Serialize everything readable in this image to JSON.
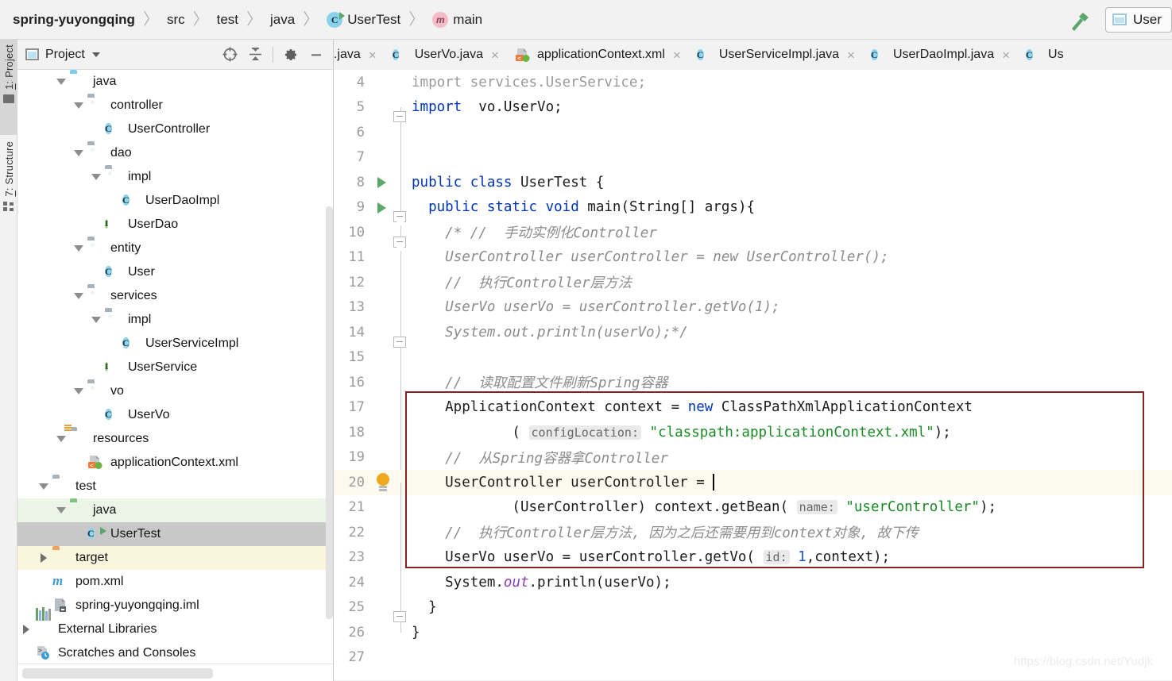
{
  "breadcrumb": {
    "items": [
      {
        "label": "spring-yuyongqing",
        "icon": "none",
        "bold": true
      },
      {
        "label": "src",
        "icon": "none",
        "bold": false
      },
      {
        "label": "test",
        "icon": "none",
        "bold": false
      },
      {
        "label": "java",
        "icon": "none",
        "bold": false
      },
      {
        "label": "UserTest",
        "icon": "class-runnable-icon",
        "bold": false
      },
      {
        "label": "main",
        "icon": "method-icon",
        "bold": false
      }
    ],
    "separator": "〉"
  },
  "toolbar": {
    "build_icon": "hammer-icon",
    "run_config_label": "User",
    "run_config_icon": "run-configuration-icon"
  },
  "tool_strip": {
    "tabs": [
      {
        "num": "1:",
        "label": " Project",
        "icon": "project-folder-icon",
        "active": true
      },
      {
        "num": "7:",
        "label": " Structure",
        "icon": "structure-icon",
        "active": false
      }
    ]
  },
  "project_panel": {
    "title": "Project",
    "title_icon": "project-window-icon",
    "dropdown_icon": "chevron-down-icon",
    "header_buttons": [
      {
        "name": "locate-icon",
        "tooltip": "Select Opened File"
      },
      {
        "name": "collapse-all-icon",
        "tooltip": "Collapse All"
      },
      {
        "name": "gear-icon",
        "tooltip": "Settings"
      },
      {
        "name": "minimize-icon",
        "tooltip": "Hide"
      }
    ],
    "tree": [
      {
        "label": "java",
        "depth": 3,
        "icon": "folder-source-blue-icon",
        "twisty": "open",
        "state": "normal"
      },
      {
        "label": "controller",
        "depth": 4,
        "icon": "folder-package-icon",
        "twisty": "open",
        "state": "normal"
      },
      {
        "label": "UserController",
        "depth": 5,
        "icon": "class-icon",
        "twisty": "none",
        "state": "normal"
      },
      {
        "label": "dao",
        "depth": 4,
        "icon": "folder-package-icon",
        "twisty": "open",
        "state": "normal"
      },
      {
        "label": "impl",
        "depth": 5,
        "icon": "folder-package-icon",
        "twisty": "open",
        "state": "normal"
      },
      {
        "label": "UserDaoImpl",
        "depth": 6,
        "icon": "class-icon",
        "twisty": "none",
        "state": "normal"
      },
      {
        "label": "UserDao",
        "depth": 5,
        "icon": "interface-icon",
        "twisty": "none",
        "state": "normal"
      },
      {
        "label": "entity",
        "depth": 4,
        "icon": "folder-package-icon",
        "twisty": "open",
        "state": "normal"
      },
      {
        "label": "User",
        "depth": 5,
        "icon": "class-icon",
        "twisty": "none",
        "state": "normal"
      },
      {
        "label": "services",
        "depth": 4,
        "icon": "folder-package-icon",
        "twisty": "open",
        "state": "normal"
      },
      {
        "label": "impl",
        "depth": 5,
        "icon": "folder-package-icon",
        "twisty": "open",
        "state": "normal"
      },
      {
        "label": "UserServiceImpl",
        "depth": 6,
        "icon": "class-icon",
        "twisty": "none",
        "state": "normal"
      },
      {
        "label": "UserService",
        "depth": 5,
        "icon": "interface-icon",
        "twisty": "none",
        "state": "normal"
      },
      {
        "label": "vo",
        "depth": 4,
        "icon": "folder-package-icon",
        "twisty": "open",
        "state": "normal"
      },
      {
        "label": "UserVo",
        "depth": 5,
        "icon": "class-icon",
        "twisty": "none",
        "state": "normal"
      },
      {
        "label": "resources",
        "depth": 3,
        "icon": "folder-resources-icon",
        "twisty": "open",
        "state": "normal"
      },
      {
        "label": "applicationContext.xml",
        "depth": 4,
        "icon": "spring-xml-icon",
        "twisty": "none",
        "state": "normal"
      },
      {
        "label": "test",
        "depth": 2,
        "icon": "folder-gray-icon",
        "twisty": "open",
        "state": "normal"
      },
      {
        "label": "java",
        "depth": 3,
        "icon": "folder-test-green-icon",
        "twisty": "open",
        "state": "test-root"
      },
      {
        "label": "UserTest",
        "depth": 4,
        "icon": "class-runnable-icon",
        "twisty": "none",
        "state": "selected"
      },
      {
        "label": "target",
        "depth": 2,
        "icon": "folder-excluded-icon",
        "twisty": "closed",
        "state": "excluded"
      },
      {
        "label": "pom.xml",
        "depth": 2,
        "icon": "maven-icon",
        "twisty": "none",
        "state": "normal"
      },
      {
        "label": "spring-yuyongqing.iml",
        "depth": 2,
        "icon": "iml-module-icon",
        "twisty": "none",
        "state": "normal"
      },
      {
        "label": "External Libraries",
        "depth": 1,
        "icon": "libraries-icon",
        "twisty": "closed",
        "state": "normal"
      },
      {
        "label": "Scratches and Consoles",
        "depth": 1,
        "icon": "scratches-icon",
        "twisty": "none",
        "state": "normal"
      }
    ]
  },
  "editor_tabs": [
    {
      "label": ".java",
      "icon": "none",
      "clipped": true,
      "close": "×"
    },
    {
      "label": "UserVo.java",
      "icon": "class-icon",
      "clipped": false,
      "close": "×"
    },
    {
      "label": "applicationContext.xml",
      "icon": "spring-xml-icon",
      "clipped": false,
      "close": "×"
    },
    {
      "label": "UserServiceImpl.java",
      "icon": "class-icon",
      "clipped": false,
      "close": "×"
    },
    {
      "label": "UserDaoImpl.java",
      "icon": "class-icon",
      "clipped": false,
      "close": "×"
    },
    {
      "label": "Us",
      "icon": "class-icon",
      "clipped": false,
      "close": ""
    }
  ],
  "code": {
    "first_visible_line": 4,
    "lines": [
      {
        "num": "4",
        "gutter": "",
        "fold": "",
        "highlight": false
      },
      {
        "num": "5",
        "gutter": "",
        "fold": "end",
        "highlight": false
      },
      {
        "num": "6",
        "gutter": "",
        "fold": "",
        "highlight": false
      },
      {
        "num": "7",
        "gutter": "",
        "fold": "",
        "highlight": false
      },
      {
        "num": "8",
        "gutter": "run",
        "fold": "",
        "highlight": false
      },
      {
        "num": "9",
        "gutter": "run",
        "fold": "start",
        "highlight": false
      },
      {
        "num": "10",
        "gutter": "",
        "fold": "start",
        "highlight": false
      },
      {
        "num": "11",
        "gutter": "",
        "fold": "",
        "highlight": false
      },
      {
        "num": "12",
        "gutter": "",
        "fold": "",
        "highlight": false
      },
      {
        "num": "13",
        "gutter": "",
        "fold": "",
        "highlight": false
      },
      {
        "num": "14",
        "gutter": "",
        "fold": "end",
        "highlight": false
      },
      {
        "num": "15",
        "gutter": "",
        "fold": "",
        "highlight": false
      },
      {
        "num": "16",
        "gutter": "",
        "fold": "",
        "highlight": false
      },
      {
        "num": "17",
        "gutter": "",
        "fold": "",
        "highlight": false
      },
      {
        "num": "18",
        "gutter": "",
        "fold": "",
        "highlight": false
      },
      {
        "num": "19",
        "gutter": "",
        "fold": "",
        "highlight": false
      },
      {
        "num": "20",
        "gutter": "bulb",
        "fold": "",
        "highlight": true
      },
      {
        "num": "21",
        "gutter": "",
        "fold": "",
        "highlight": false
      },
      {
        "num": "22",
        "gutter": "",
        "fold": "",
        "highlight": false
      },
      {
        "num": "23",
        "gutter": "",
        "fold": "",
        "highlight": false
      },
      {
        "num": "24",
        "gutter": "",
        "fold": "",
        "highlight": false
      },
      {
        "num": "25",
        "gutter": "",
        "fold": "end",
        "highlight": false
      },
      {
        "num": "26",
        "gutter": "",
        "fold": "",
        "highlight": false
      },
      {
        "num": "27",
        "gutter": "",
        "fold": "",
        "highlight": false
      }
    ],
    "source_text": [
      "import services.UserService;",
      "import vo.UserVo;",
      "",
      "",
      "public class UserTest {",
      "  public static void main(String[] args){",
      "    /* //  手动实例化Controller",
      "    UserController userController = new UserController();",
      "    //  执行Controller层方法",
      "    UserVo userVo = userController.getVo(1);",
      "    System.out.println(userVo);*/",
      "",
      "    //  读取配置文件刷新Spring容器",
      "    ApplicationContext context = new ClassPathXmlApplicationContext",
      "            ( configLocation: \"classpath:applicationContext.xml\");",
      "    //  从Spring容器拿Controller",
      "    UserController userController = ",
      "            (UserController) context.getBean( name: \"userController\");",
      "    //  执行Controller层方法, 因为之后还需要用到context对象, 故下传",
      "    UserVo userVo = userController.getVo( id: 1,context);",
      "    System.out.println(userVo);",
      "  }",
      "}",
      ""
    ],
    "inlay_hints": [
      "configLocation:",
      "name:",
      "id:"
    ],
    "highlight_box": {
      "from_line": "17",
      "to_line": "23",
      "color": "#8b2020"
    },
    "caret_line": "20"
  },
  "watermark": "https://blog.csdn.net/Yudjk",
  "colors": {
    "keyword": "#0033b3",
    "string": "#1a8a24",
    "number": "#1750eb",
    "comment": "#8c8c8c",
    "static_field": "#8d3fb5",
    "selection": "#c8c8c8",
    "test_root": "#eaf5e7",
    "excluded": "#faf6dd",
    "caret_row": "#fcfaef",
    "box_border": "#8b2020"
  }
}
